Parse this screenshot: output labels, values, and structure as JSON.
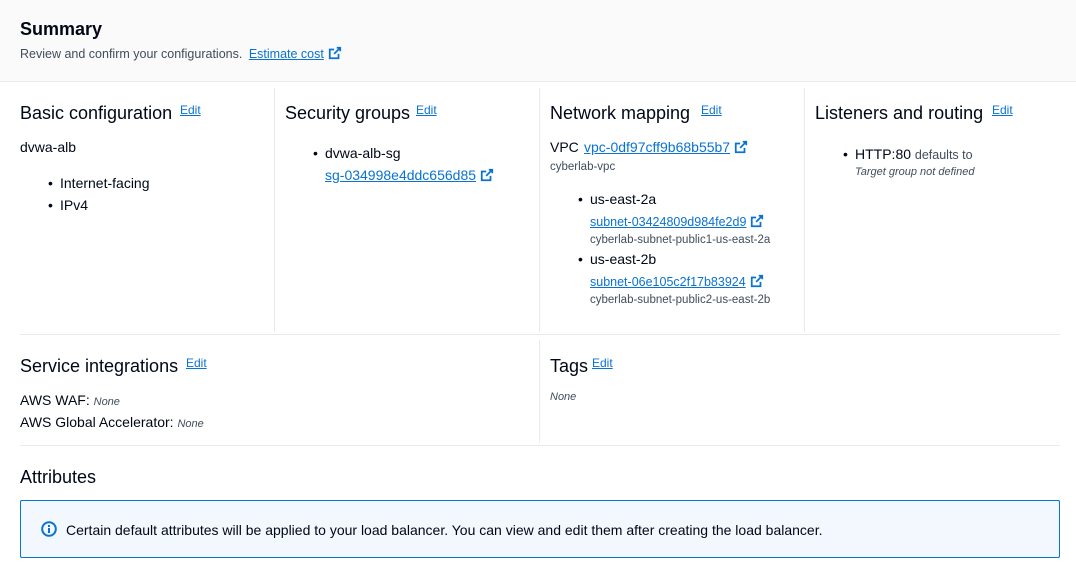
{
  "summary": {
    "title": "Summary",
    "description": "Review and confirm your configurations.",
    "estimate_cost": "Estimate cost"
  },
  "basic": {
    "title": "Basic configuration",
    "edit": "Edit",
    "name": "dvwa-alb",
    "items": [
      "Internet-facing",
      "IPv4"
    ]
  },
  "security": {
    "title": "Security groups",
    "edit": "Edit",
    "group_name": "dvwa-alb-sg",
    "group_id": "sg-034998e4ddc656d85"
  },
  "network": {
    "title": "Network mapping",
    "edit": "Edit",
    "vpc_label": "VPC",
    "vpc_id": "vpc-0df97cff9b68b55b7",
    "vpc_name": "cyberlab-vpc",
    "zones": [
      {
        "zone": "us-east-2a",
        "subnet_id": "subnet-03424809d984fe2d9",
        "subnet_name": "cyberlab-subnet-public1-us-east-2a"
      },
      {
        "zone": "us-east-2b",
        "subnet_id": "subnet-06e105c2f17b83924",
        "subnet_name": "cyberlab-subnet-public2-us-east-2b"
      }
    ]
  },
  "listeners": {
    "title": "Listeners and routing",
    "edit": "Edit",
    "listener": "HTTP:80",
    "defaults_to": "defaults to",
    "target": "Target group not defined"
  },
  "services": {
    "title": "Service integrations",
    "edit": "Edit",
    "waf_label": "AWS WAF:",
    "waf_value": "None",
    "ga_label": "AWS Global Accelerator:",
    "ga_value": "None"
  },
  "tags": {
    "title": "Tags",
    "edit": "Edit",
    "value": "None"
  },
  "attributes": {
    "title": "Attributes",
    "message": "Certain default attributes will be applied to your load balancer. You can view and edit them after creating the load balancer."
  },
  "colors": {
    "link": "#0972d3",
    "text": "#000716",
    "muted": "#414d5c",
    "divider": "#e9ebed",
    "info_bg": "#f2f8fd"
  },
  "icons": [
    "external-link-icon",
    "info-icon"
  ]
}
